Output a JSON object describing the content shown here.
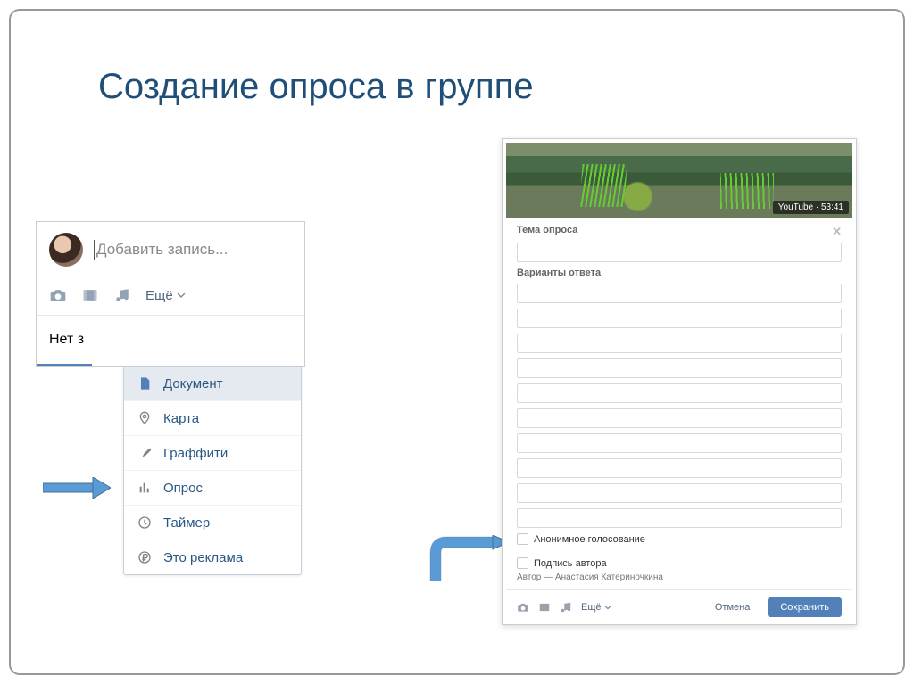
{
  "slide": {
    "title": "Создание опроса в группе"
  },
  "composer": {
    "placeholder": "Добавить запись...",
    "more_label": "Ещё",
    "no_entries": "Нет з"
  },
  "dropdown": {
    "items": [
      {
        "label": "Документ",
        "icon": "document-icon"
      },
      {
        "label": "Карта",
        "icon": "map-pin-icon"
      },
      {
        "label": "Граффити",
        "icon": "brush-icon"
      },
      {
        "label": "Опрос",
        "icon": "poll-icon"
      },
      {
        "label": "Таймер",
        "icon": "clock-icon"
      },
      {
        "label": "Это реклама",
        "icon": "ruble-icon"
      }
    ]
  },
  "poll": {
    "video_badge": "YouTube · 53:41",
    "topic_label": "Тема опроса",
    "answers_label": "Варианты ответа",
    "answer_count": 10,
    "anon_label": "Анонимное голосование",
    "signature_label": "Подпись автора",
    "author_prefix": "Автор — ",
    "author_name": "Анастасия Катериночкина",
    "more_label": "Ещё",
    "cancel": "Отмена",
    "save": "Сохранить"
  }
}
